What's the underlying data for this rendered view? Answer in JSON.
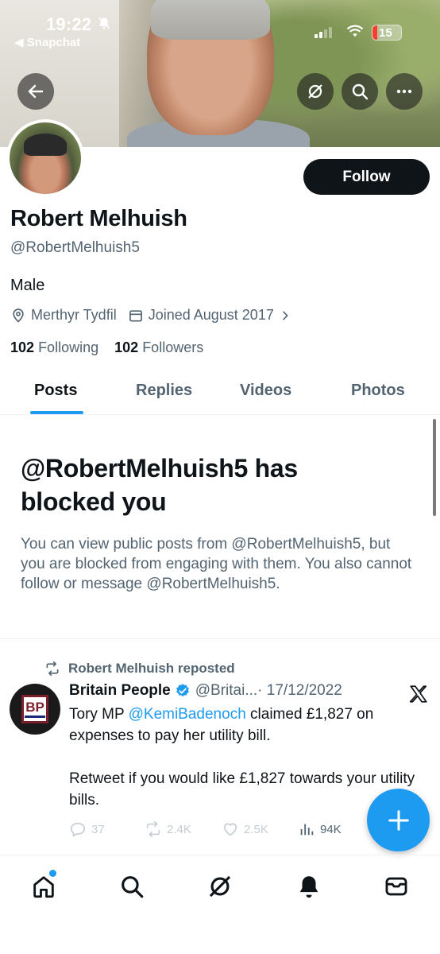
{
  "status_bar": {
    "time": "19:22",
    "back_app": "◀ Snapchat",
    "battery": "15"
  },
  "profile": {
    "name": "Robert Melhuish",
    "handle": "@RobertMelhuish5",
    "bio": "Male",
    "location": "Merthyr Tydfil",
    "joined": "Joined August 2017",
    "following_count": "102",
    "following_label": "Following",
    "followers_count": "102",
    "followers_label": "Followers",
    "follow_button": "Follow"
  },
  "tabs": [
    {
      "label": "Posts",
      "active": true
    },
    {
      "label": "Replies",
      "active": false
    },
    {
      "label": "Videos",
      "active": false
    },
    {
      "label": "Photos",
      "active": false
    }
  ],
  "blocked": {
    "title": "@RobertMelhuish5 has blocked you",
    "description": "You can view public posts from @RobertMelhuish5, but you are blocked from engaging with them. You also cannot follow or message @RobertMelhuish5."
  },
  "post": {
    "repost_label": "Robert Melhuish reposted",
    "author_name": "Britain People",
    "author_handle": "@Britai...",
    "date": "· 17/12/2022",
    "avatar_text": "BP",
    "text_before": "Tory MP ",
    "mention": "@KemiBadenoch",
    "text_after": " claimed £1,827 on expenses to pay her utility bill.\n\nRetweet if you would like £1,827 towards your utility bills.",
    "replies": "37",
    "reposts": "2.4K",
    "likes": "2.5K",
    "views": "94K"
  },
  "icons": {
    "back": "back-arrow-icon",
    "grok": "grok-icon",
    "search": "search-icon",
    "more": "more-icon",
    "location": "location-pin-icon",
    "calendar": "calendar-icon",
    "repost": "repost-icon",
    "verified": "verified-badge-icon",
    "x_logo": "x-logo-icon",
    "compose": "plus-icon"
  },
  "colors": {
    "accent": "#1d9bf0",
    "text_primary": "#0f1419",
    "text_secondary": "#536471"
  }
}
